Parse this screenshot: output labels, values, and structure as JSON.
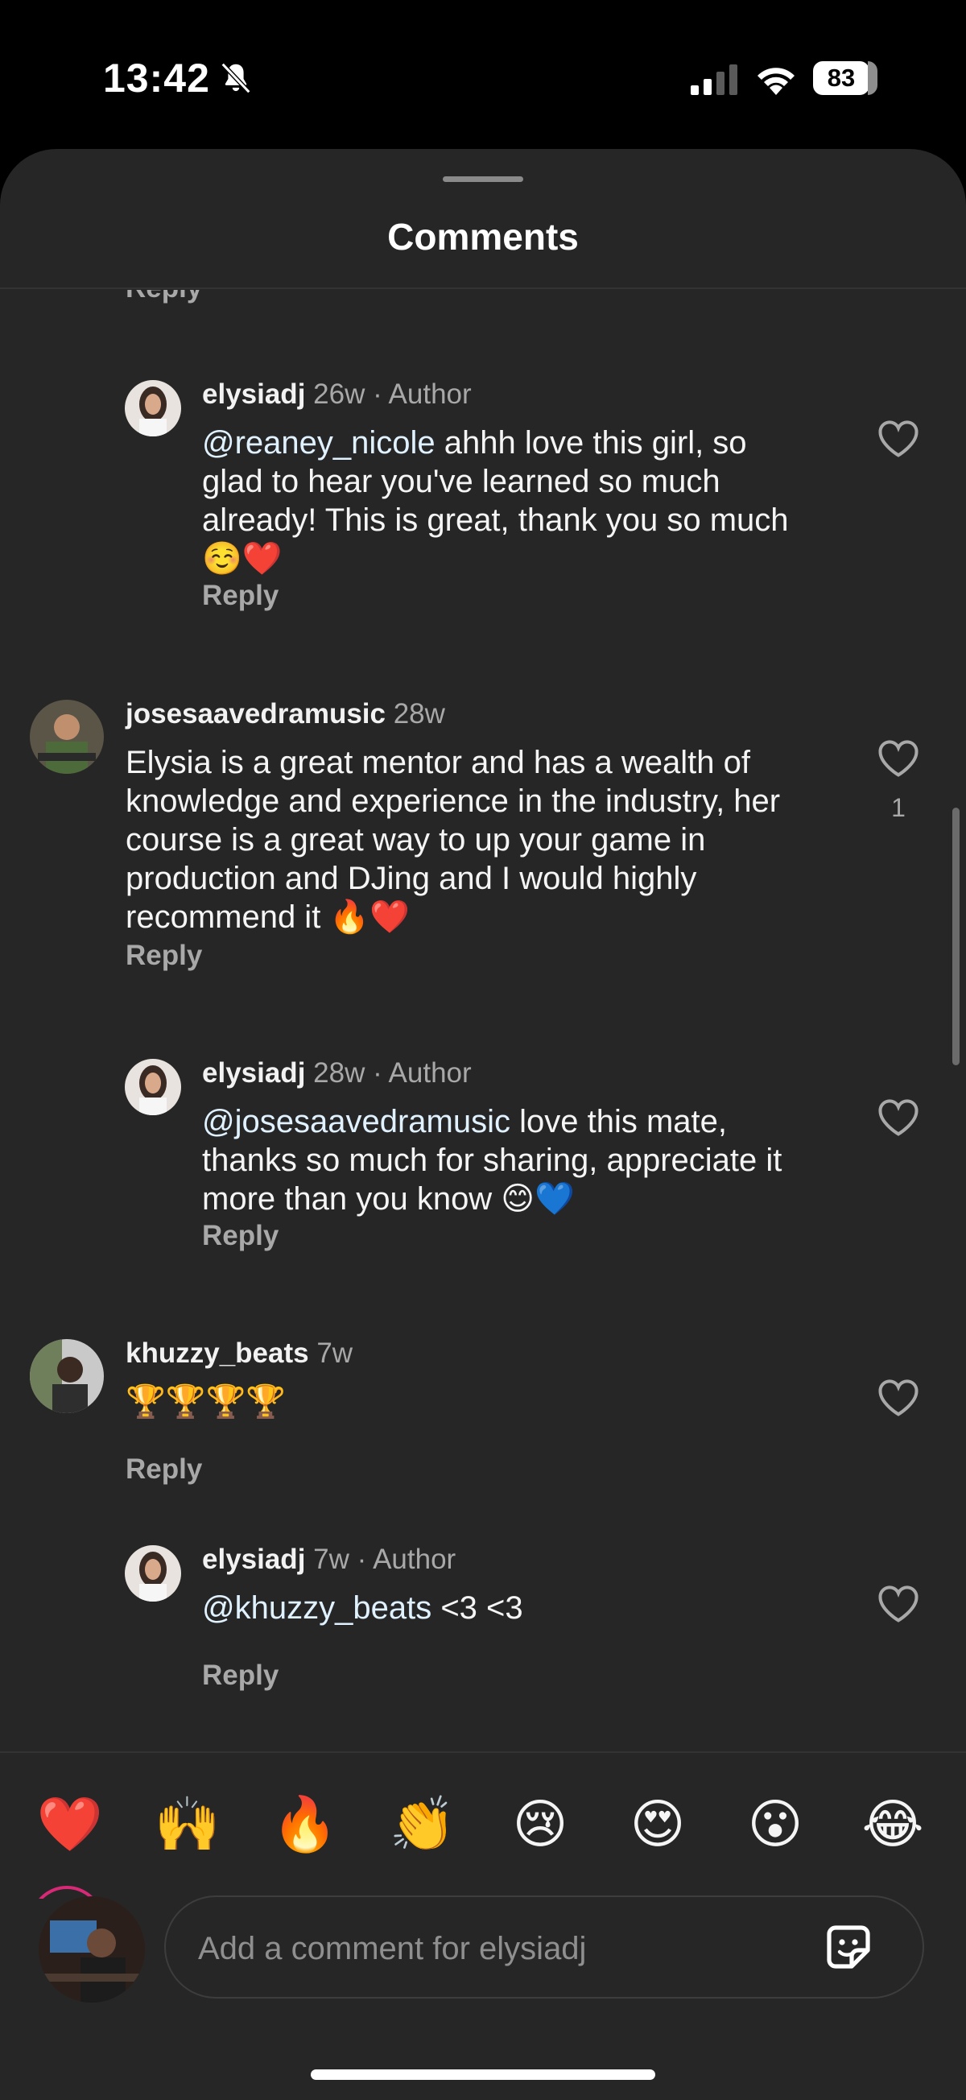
{
  "status_bar": {
    "time": "13:42",
    "battery": "83",
    "icons": [
      "bell-slash-icon",
      "cellular-signal-icon",
      "wifi-icon",
      "battery-icon"
    ]
  },
  "sheet": {
    "title": "Comments"
  },
  "partial_reply_label": "Reply",
  "comments": [
    {
      "username": "elysiadj",
      "meta": "26w · Author",
      "mention": "@reaney_nicole",
      "text": " ahhh love this girl, so glad to hear you've learned so much already! This is great, thank you so much ☺️❤️",
      "reply_label": "Reply",
      "like_count": ""
    },
    {
      "username": "josesaavedramusic",
      "meta": "28w",
      "mention": "",
      "text": "Elysia is a great mentor and has a wealth of knowledge and experience in the industry, her course is a great way to up your game in production and DJing and I would highly recommend it 🔥❤️",
      "reply_label": "Reply",
      "like_count": "1"
    },
    {
      "username": "elysiadj",
      "meta": "28w · Author",
      "mention": "@josesaavedramusic",
      "text": " love this mate, thanks so much for sharing, appreciate it more than you know 😊💙",
      "reply_label": "Reply",
      "like_count": ""
    },
    {
      "username": "khuzzy_beats",
      "meta": "7w",
      "mention": "",
      "text": "🏆🏆🏆🏆",
      "reply_label": "Reply",
      "like_count": ""
    },
    {
      "username": "elysiadj",
      "meta": "7w · Author",
      "mention": "@khuzzy_beats",
      "text": " <3 <3",
      "reply_label": "Reply",
      "like_count": ""
    }
  ],
  "quick_reactions": [
    "❤️",
    "🙌",
    "🔥",
    "👏",
    "😢",
    "😍",
    "😮",
    "😂"
  ],
  "composer": {
    "placeholder": "Add a comment for elysiadj"
  },
  "colors": {
    "background": "#262626",
    "text": "#f5f5f5",
    "secondary": "#a8a8a8",
    "mention": "#e0f1ff"
  }
}
